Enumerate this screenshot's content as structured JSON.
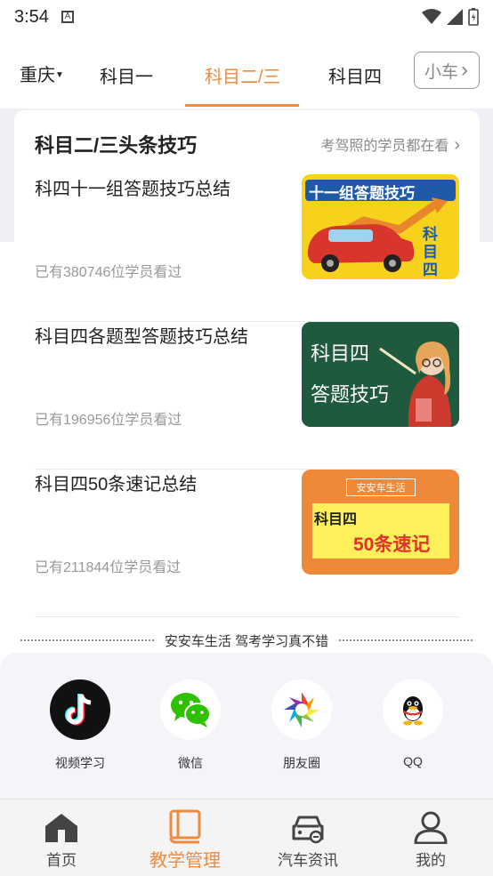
{
  "status_bar": {
    "time": "3:54",
    "notif": "A"
  },
  "header": {
    "city": "重庆",
    "tabs": [
      {
        "label": "科目一",
        "active": false
      },
      {
        "label": "科目二/三",
        "active": true
      },
      {
        "label": "科目四",
        "active": false
      },
      {
        "label": "小车",
        "active": false
      }
    ]
  },
  "section": {
    "title": "科目二/三头条技巧",
    "subtitle": "考驾照的学员都在看",
    "articles": [
      {
        "title": "科四十一组答题技巧总结",
        "meta": "已有380746位学员看过",
        "thumb_banner": "十一组答题技巧",
        "thumb_side": "科目四"
      },
      {
        "title": "科目四各题型答题技巧总结",
        "meta": "已有196956位学员看过",
        "thumb_line1": "科目四",
        "thumb_line2": "答题技巧"
      },
      {
        "title": "科目四50条速记总结",
        "meta": "已有211844位学员看过",
        "thumb_brand": "安安车生活",
        "thumb_line1": "科目四",
        "thumb_line2": "50条速记"
      }
    ]
  },
  "slogan": "安安车生活 驾考学习真不错",
  "share": [
    {
      "label": "视频学习",
      "icon": "tiktok-icon"
    },
    {
      "label": "微信",
      "icon": "wechat-icon"
    },
    {
      "label": "朋友圈",
      "icon": "moments-icon"
    },
    {
      "label": "QQ",
      "icon": "qq-icon"
    }
  ],
  "bottom_nav": [
    {
      "label": "首页",
      "icon": "home-icon",
      "active": false
    },
    {
      "label": "教学管理",
      "icon": "book-icon",
      "active": true
    },
    {
      "label": "汽车资讯",
      "icon": "car-icon",
      "active": false
    },
    {
      "label": "我的",
      "icon": "user-icon",
      "active": false
    }
  ],
  "colors": {
    "accent": "#f08a3c",
    "panel": "#f4f5f9"
  }
}
